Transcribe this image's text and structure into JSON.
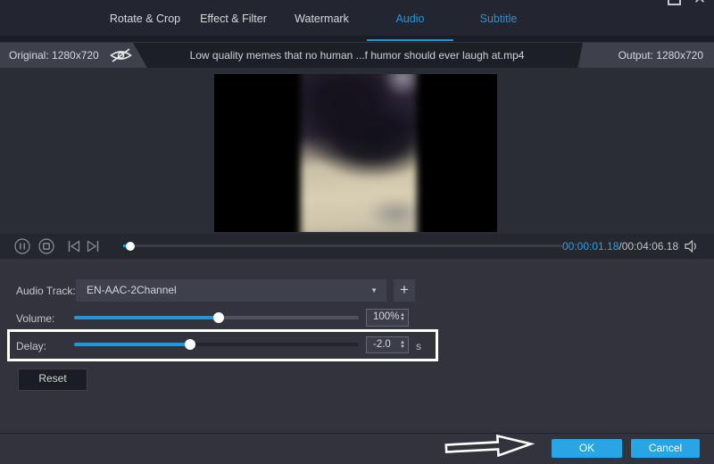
{
  "window": {
    "maximize_icon": "maximize-square",
    "close_icon": "✕"
  },
  "tabs": {
    "items": [
      {
        "label": "Rotate & Crop"
      },
      {
        "label": "Effect & Filter"
      },
      {
        "label": "Watermark"
      },
      {
        "label": "Audio"
      },
      {
        "label": "Subtitle"
      }
    ],
    "active": "Audio"
  },
  "header": {
    "original": "Original: 1280x720",
    "filename": "Low quality memes that no human ...f humor should ever laugh at.mp4",
    "output": "Output: 1280x720"
  },
  "player": {
    "current_time": "00:00:01.18",
    "total_time": "/00:04:06.18",
    "progress_percent": 1.5
  },
  "audio_panel": {
    "track_label": "Audio Track:",
    "track_value": "EN-AAC-2Channel",
    "add_track_label": "+",
    "volume_label": "Volume:",
    "volume_value": "100%",
    "volume_percent": 50.8,
    "delay_label": "Delay:",
    "delay_value": "-2.0",
    "delay_unit": "s",
    "delay_percent": 40.8,
    "reset_label": "Reset"
  },
  "footer": {
    "ok_label": "OK",
    "cancel_label": "Cancel"
  },
  "icons": {
    "caret_down": "▼",
    "spinner_up": "▲",
    "spinner_down": "▼"
  },
  "colors": {
    "accent": "#2196d8",
    "button_blue": "#28a5e5",
    "highlight_border": "#ffffff",
    "background": "#32333d"
  }
}
